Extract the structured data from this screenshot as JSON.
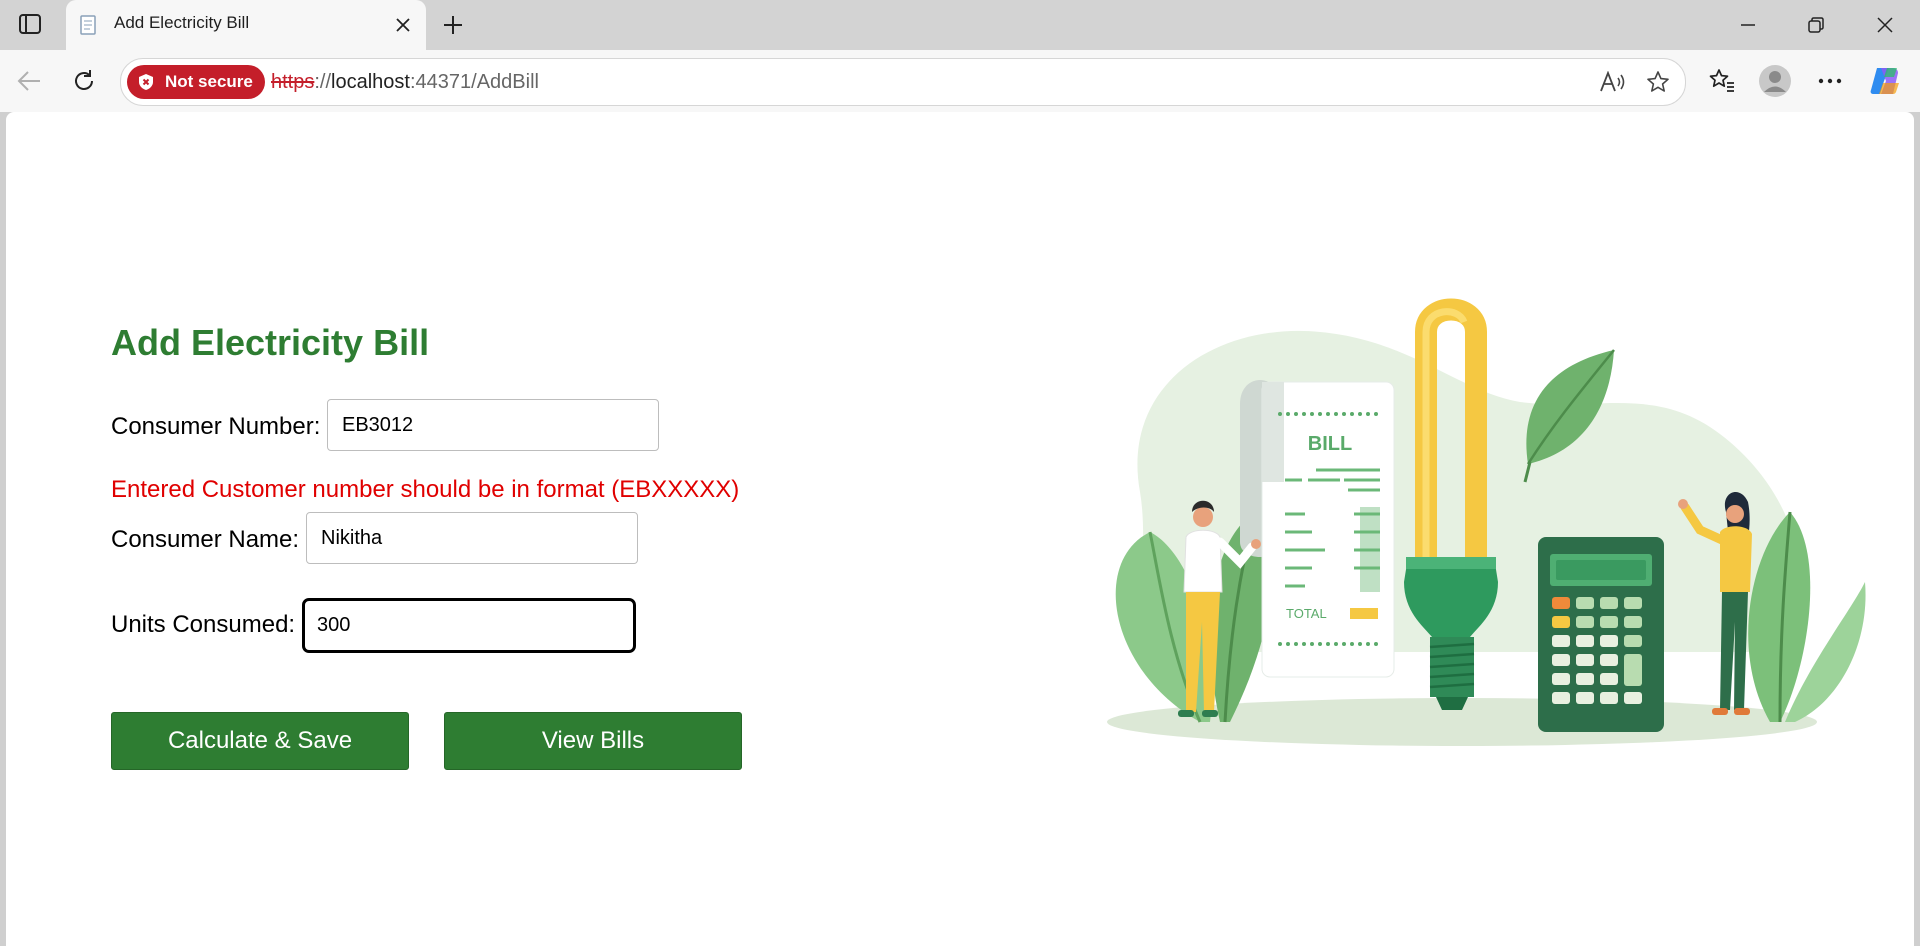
{
  "browser": {
    "tab_title": "Add Electricity Bill",
    "security_badge": "Not secure",
    "url_scheme": "https",
    "url_sep": "://",
    "url_host": "localhost",
    "url_rest": ":44371/AddBill"
  },
  "form": {
    "title": "Add Electricity Bill",
    "consumer_number_label": "Consumer Number:",
    "consumer_number_value": "EB3012",
    "error_message": "Entered Customer number should be in format (EBXXXXX)",
    "consumer_name_label": "Consumer Name:",
    "consumer_name_value": "Nikitha",
    "units_label": "Units Consumed:",
    "units_value": "300",
    "calculate_button": "Calculate & Save",
    "view_button": "View Bills"
  },
  "illustration": {
    "bill_heading": "BILL",
    "total_label": "TOTAL"
  },
  "colors": {
    "accent_green": "#2e7d32",
    "error_red": "#e00000",
    "badge_red": "#c41e2a"
  },
  "icons": [
    "tab-actions-icon",
    "favicon-icon",
    "close-icon",
    "plus-icon",
    "minimize-icon",
    "restore-icon",
    "window-close-icon",
    "back-icon",
    "refresh-icon",
    "shield-icon",
    "read-aloud-icon",
    "star-icon",
    "favorites-icon",
    "profile-icon",
    "more-icon",
    "copilot-icon"
  ]
}
